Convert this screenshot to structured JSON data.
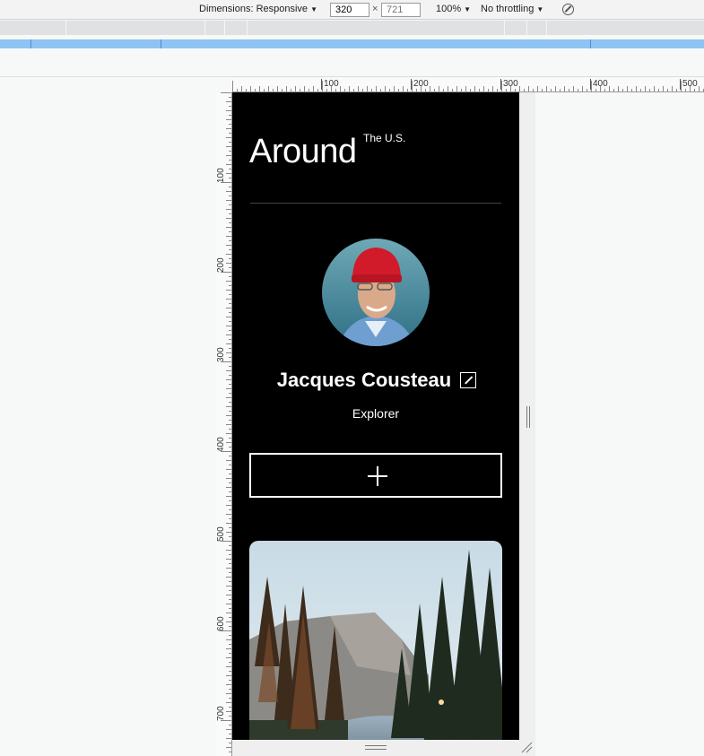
{
  "devtools": {
    "dimensions_label": "Dimensions: Responsive",
    "width_value": "320",
    "height_placeholder": "721",
    "times": "×",
    "zoom": "100%",
    "throttling": "No throttling",
    "rotate_icon": "rotate-icon"
  },
  "rulers": {
    "top_labels": [
      "100",
      "200",
      "300",
      "400",
      "500"
    ],
    "left_labels": [
      "100",
      "200",
      "300",
      "400",
      "500",
      "600",
      "700"
    ]
  },
  "page": {
    "logo": "Around",
    "logo_sup": "The U.S.",
    "profile_name": "Jacques Cousteau",
    "profile_job": "Explorer",
    "edit_icon": "edit-icon",
    "add_icon": "plus-icon",
    "colors": {
      "background": "#000000",
      "text": "#ffffff",
      "hat": "#d11a2a"
    }
  }
}
